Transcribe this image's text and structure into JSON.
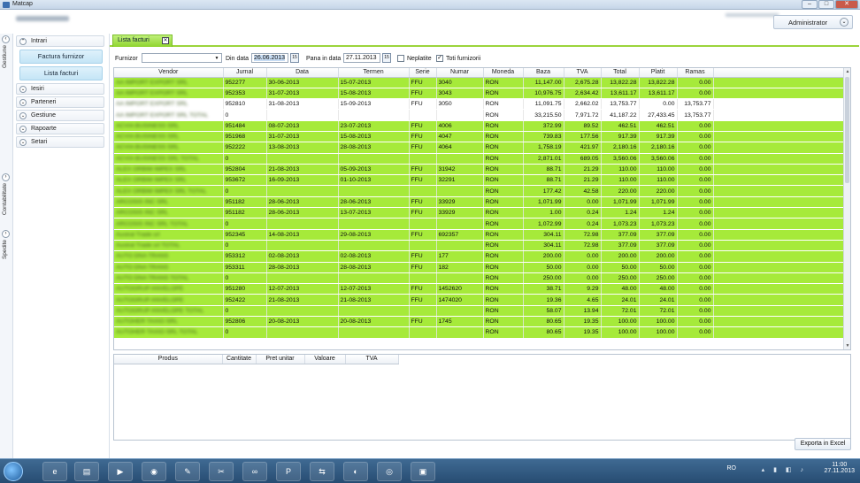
{
  "window": {
    "title": "Matcap"
  },
  "header": {
    "user_button": "Administrator"
  },
  "side_tabs": [
    "Gestiune",
    "Contabilitate",
    "Spedite"
  ],
  "nav": {
    "sections": [
      {
        "label": "Intrari",
        "expanded": true,
        "buttons": [
          "Factura furnizor",
          "Lista facturi"
        ]
      },
      {
        "label": "Iesiri",
        "expanded": false
      },
      {
        "label": "Parteneri",
        "expanded": false
      },
      {
        "label": "Gestiune",
        "expanded": false
      },
      {
        "label": "Rapoarte",
        "expanded": false
      },
      {
        "label": "Setari",
        "expanded": false
      }
    ]
  },
  "tab": {
    "label": "Lista facturi"
  },
  "filters": {
    "furnizor_label": "Furnizor",
    "furnizor_value": "",
    "din_label": "Din data",
    "din_value": "26.06.2013",
    "pana_label": "Pana in data",
    "pana_value": "27.11.2013",
    "neplatite_label": "Neplatite",
    "neplatite_checked": false,
    "toti_label": "Toti furnizorii",
    "toti_checked": true
  },
  "table": {
    "columns": [
      "Vendor",
      "Jurnal",
      "Data",
      "Termen",
      "Serie",
      "Numar",
      "Moneda",
      "Baza",
      "TVA",
      "Total",
      "Platit",
      "Ramas"
    ],
    "rows": [
      {
        "style": "g",
        "cells": [
          "AA IMPORT EXPORT SRL",
          "952277",
          "30-06-2013",
          "15-07-2013",
          "FFU",
          "3040",
          "RON",
          "11,147.00",
          "2,675.28",
          "13,822.28",
          "13,822.28",
          "0.00"
        ]
      },
      {
        "style": "g",
        "cells": [
          "AA IMPORT EXPORT SRL",
          "952353",
          "31-07-2013",
          "15-08-2013",
          "FFU",
          "3043",
          "RON",
          "10,976.75",
          "2,634.42",
          "13,611.17",
          "13,611.17",
          "0.00"
        ]
      },
      {
        "style": "w",
        "cells": [
          "AA IMPORT EXPORT SRL",
          "952810",
          "31-08-2013",
          "15-09-2013",
          "FFU",
          "3050",
          "RON",
          "11,091.75",
          "2,662.02",
          "13,753.77",
          "0.00",
          "13,753.77"
        ]
      },
      {
        "style": "w",
        "cells": [
          "AA IMPORT EXPORT SRL TOTAL",
          "0",
          "",
          "",
          "",
          "",
          "RON",
          "33,215.50",
          "7,971.72",
          "41,187.22",
          "27,433.45",
          "13,753.77"
        ]
      },
      {
        "style": "g",
        "cells": [
          "ACVIA BUSINESS SRL",
          "951484",
          "08-07-2013",
          "23-07-2013",
          "FFU",
          "4006",
          "RON",
          "372.99",
          "89.52",
          "462.51",
          "462.51",
          "0.00"
        ]
      },
      {
        "style": "g",
        "cells": [
          "ACVIA BUSINESS SRL",
          "951968",
          "31-07-2013",
          "15-08-2013",
          "FFU",
          "4047",
          "RON",
          "739.83",
          "177.56",
          "917.39",
          "917.39",
          "0.00"
        ]
      },
      {
        "style": "g",
        "cells": [
          "ACVIA BUSINESS SRL",
          "952222",
          "13-08-2013",
          "28-08-2013",
          "FFU",
          "4064",
          "RON",
          "1,758.19",
          "421.97",
          "2,180.16",
          "2,180.16",
          "0.00"
        ]
      },
      {
        "style": "g",
        "cells": [
          "ACVIA BUSINESS SRL TOTAL",
          "0",
          "",
          "",
          "",
          "",
          "RON",
          "2,871.01",
          "689.05",
          "3,560.06",
          "3,560.06",
          "0.00"
        ]
      },
      {
        "style": "g",
        "cells": [
          "ALEX ORBIM IMPEX SRL",
          "952804",
          "21-08-2013",
          "05-09-2013",
          "FFU",
          "31942",
          "RON",
          "88.71",
          "21.29",
          "110.00",
          "110.00",
          "0.00"
        ]
      },
      {
        "style": "g",
        "cells": [
          "ALEX ORBIM IMPEX SRL",
          "953672",
          "16-09-2013",
          "01-10-2013",
          "FFU",
          "32291",
          "RON",
          "88.71",
          "21.29",
          "110.00",
          "110.00",
          "0.00"
        ]
      },
      {
        "style": "g",
        "cells": [
          "ALEX ORBIM IMPEX SRL TOTAL",
          "0",
          "",
          "",
          "",
          "",
          "RON",
          "177.42",
          "42.58",
          "220.00",
          "220.00",
          "0.00"
        ]
      },
      {
        "style": "g",
        "cells": [
          "ARCOSIS INC SRL",
          "951182",
          "28-06-2013",
          "28-06-2013",
          "FFU",
          "33929",
          "RON",
          "1,071.99",
          "0.00",
          "1,071.99",
          "1,071.99",
          "0.00"
        ]
      },
      {
        "style": "g",
        "cells": [
          "ARCOSIS INC SRL",
          "951182",
          "28-06-2013",
          "13-07-2013",
          "FFU",
          "33929",
          "RON",
          "1.00",
          "0.24",
          "1.24",
          "1.24",
          "0.00"
        ]
      },
      {
        "style": "g",
        "cells": [
          "ARCOSIS INC SRL TOTAL",
          "0",
          "",
          "",
          "",
          "",
          "RON",
          "1,072.99",
          "0.24",
          "1,073.23",
          "1,073.23",
          "0.00"
        ]
      },
      {
        "style": "g",
        "cells": [
          "Austral Trade srl",
          "952345",
          "14-08-2013",
          "29-08-2013",
          "FFU",
          "692357",
          "RON",
          "304.11",
          "72.98",
          "377.09",
          "377.09",
          "0.00"
        ]
      },
      {
        "style": "g",
        "cells": [
          "Austral Trade srl TOTAL",
          "0",
          "",
          "",
          "",
          "",
          "RON",
          "304.11",
          "72.98",
          "377.09",
          "377.09",
          "0.00"
        ]
      },
      {
        "style": "g",
        "cells": [
          "AUTO DNA TRANS",
          "953312",
          "02-08-2013",
          "02-08-2013",
          "FFU",
          "177",
          "RON",
          "200.00",
          "0.00",
          "200.00",
          "200.00",
          "0.00"
        ]
      },
      {
        "style": "g",
        "cells": [
          "AUTO DNA TRANS",
          "953311",
          "28-08-2013",
          "28-08-2013",
          "FFU",
          "182",
          "RON",
          "50.00",
          "0.00",
          "50.00",
          "50.00",
          "0.00"
        ]
      },
      {
        "style": "g",
        "cells": [
          "AUTO DNA TRANS TOTAL",
          "0",
          "",
          "",
          "",
          "",
          "RON",
          "250.00",
          "0.00",
          "250.00",
          "250.00",
          "0.00"
        ]
      },
      {
        "style": "g",
        "cells": [
          "AUTOGRUP ANVELOPE",
          "951280",
          "12-07-2013",
          "12-07-2013",
          "FFU",
          "1452620",
          "RON",
          "38.71",
          "9.29",
          "48.00",
          "48.00",
          "0.00"
        ]
      },
      {
        "style": "g",
        "cells": [
          "AUTOGRUP ANVELOPE",
          "952422",
          "21-08-2013",
          "21-08-2013",
          "FFU",
          "1474020",
          "RON",
          "19.36",
          "4.65",
          "24.01",
          "24.01",
          "0.00"
        ]
      },
      {
        "style": "g",
        "cells": [
          "AUTOGRUP ANVELOPE TOTAL",
          "0",
          "",
          "",
          "",
          "",
          "RON",
          "58.07",
          "13.94",
          "72.01",
          "72.01",
          "0.00"
        ]
      },
      {
        "style": "g",
        "cells": [
          "AUTOHER TAXIO SRL",
          "952806",
          "20-08-2013",
          "20-08-2013",
          "FFU",
          "1745",
          "RON",
          "80.65",
          "19.35",
          "100.00",
          "100.00",
          "0.00"
        ]
      },
      {
        "style": "g",
        "cells": [
          "AUTOHER TAXIO SRL TOTAL",
          "0",
          "",
          "",
          "",
          "",
          "RON",
          "80.65",
          "19.35",
          "100.00",
          "100.00",
          "0.00"
        ]
      }
    ]
  },
  "detail_table": {
    "columns": [
      "Produs",
      "Cantitate",
      "Pret unitar",
      "Valoare",
      "TVA"
    ]
  },
  "export_button": "Exporta in Excel",
  "taskbar": {
    "language": "RO",
    "time": "11:00",
    "date": "27.11.2013"
  },
  "colors": {
    "row_green": "#a6ea3a",
    "tab_green": "#8fd42e"
  }
}
